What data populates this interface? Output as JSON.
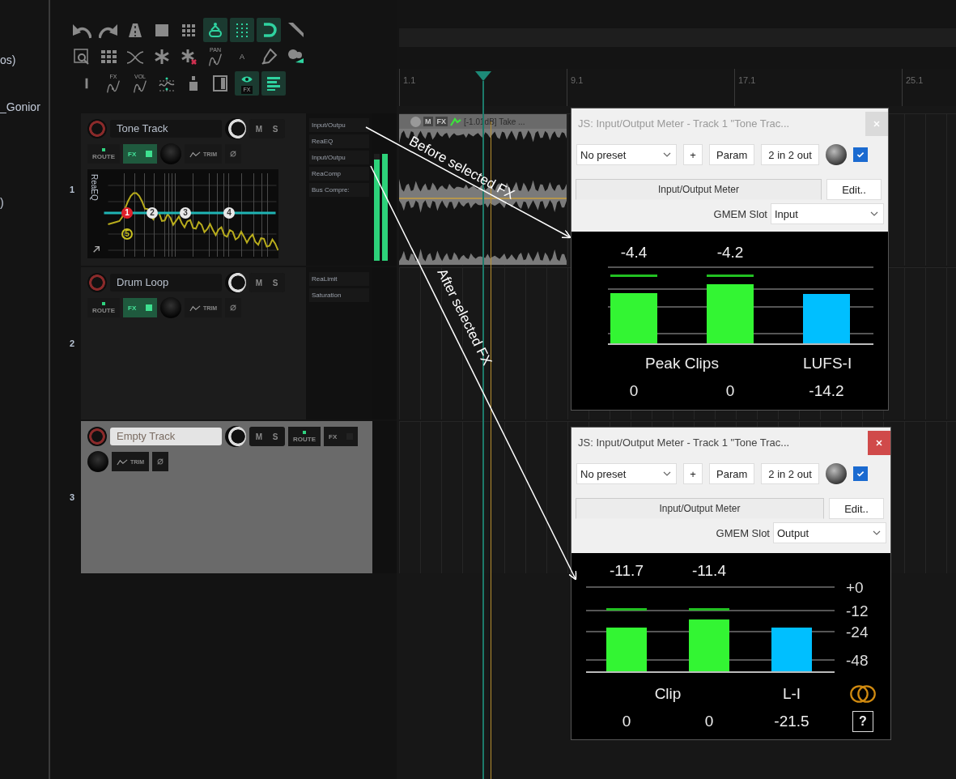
{
  "sidebar": {
    "items": [
      "os)",
      "_Gonior",
      ")"
    ]
  },
  "toolbar": {
    "rows": [
      [
        {
          "kind": "undo",
          "on": false
        },
        {
          "kind": "redo",
          "on": false
        },
        {
          "kind": "road",
          "on": false
        },
        {
          "kind": "square",
          "on": false
        },
        {
          "kind": "grid",
          "on": false
        },
        {
          "kind": "link",
          "on": true
        },
        {
          "kind": "dots",
          "on": true
        },
        {
          "kind": "magnet",
          "on": true
        },
        {
          "kind": "ruler",
          "on": false
        }
      ],
      [
        {
          "kind": "zoom",
          "on": false
        },
        {
          "kind": "table",
          "on": false
        },
        {
          "kind": "crossfade",
          "on": false
        },
        {
          "kind": "snowflake",
          "on": false
        },
        {
          "kind": "snowflake-x",
          "on": false
        },
        {
          "kind": "envelope",
          "label": "PAN",
          "on": false
        },
        {
          "kind": "text",
          "label": "A",
          "on": false
        },
        {
          "kind": "pin",
          "on": false
        },
        {
          "kind": "people",
          "on": false
        }
      ],
      [
        {
          "kind": "bar",
          "on": false
        },
        {
          "kind": "envelope",
          "label": "FX",
          "on": false
        },
        {
          "kind": "envelope",
          "label": "VOL",
          "on": false
        },
        {
          "kind": "points",
          "on": false
        },
        {
          "kind": "bottle",
          "on": false
        },
        {
          "kind": "panel",
          "on": false
        },
        {
          "kind": "eye",
          "label": "FX",
          "on": true
        },
        {
          "kind": "mixer",
          "on": true
        }
      ]
    ]
  },
  "tracks": [
    {
      "number": "1",
      "name": "Tone Track",
      "selected": false,
      "mute": "M",
      "solo": "S",
      "route": "ROUTE",
      "fx_button": "FX",
      "fx_enabled": true,
      "trim": "TRIM",
      "fx": [
        "Input/Outpu",
        "ReaEQ",
        "Input/Outpu",
        "ReaComp",
        "Bus Compre:"
      ],
      "meter": [
        {
          "level": 0.95
        },
        {
          "level": 1.0
        }
      ],
      "eq": {
        "title": "ReaEQ",
        "nodes": [
          {
            "label": "1",
            "kind": "filled",
            "color": "#e0202a"
          },
          {
            "label": "2",
            "kind": "filled",
            "color": "#e8e8e8"
          },
          {
            "label": "3",
            "kind": "filled",
            "color": "#e8e8e8"
          },
          {
            "label": "4",
            "kind": "filled",
            "color": "#e8e8e8"
          },
          {
            "label": "5",
            "kind": "outline",
            "color": "#c8c020"
          }
        ]
      },
      "item": {
        "mute": "M",
        "fx": "FX",
        "label": "[-1.01dB] Take ..."
      }
    },
    {
      "number": "2",
      "name": "Drum Loop",
      "selected": false,
      "mute": "M",
      "solo": "S",
      "route": "ROUTE",
      "fx_button": "FX",
      "fx_enabled": true,
      "trim": "TRIM",
      "fx": [
        "ReaLimit",
        "Saturation"
      ]
    },
    {
      "number": "3",
      "name": "Empty Track",
      "selected": true,
      "mute": "M",
      "solo": "S",
      "route": "ROUTE",
      "fx_button": "FX",
      "fx_enabled": false,
      "trim": "TRIM"
    }
  ],
  "ruler": [
    "1.1",
    "9.1",
    "17.1",
    "25.1"
  ],
  "annotations": [
    {
      "text": "Before selected FX"
    },
    {
      "text": "After selected FX"
    }
  ],
  "windows": [
    {
      "title": "JS: Input/Output Meter - Track 1 \"Tone Trac...",
      "active": false,
      "preset": "No preset",
      "add": "+",
      "param": "Param",
      "io": "2 in 2 out",
      "enabled": true,
      "name_field": "Input/Output Meter",
      "edit": "Edit..",
      "slot_label": "GMEM Slot",
      "slot": "Input",
      "meter": {
        "readouts": [
          "-4.4",
          "-4.2"
        ],
        "bars": [
          {
            "kind": "peak"
          },
          {
            "kind": "peak"
          },
          {
            "kind": "loudness"
          }
        ],
        "labels": [
          "Peak Clips",
          "LUFS-I"
        ],
        "values": [
          "0",
          "0",
          "-14.2"
        ]
      }
    },
    {
      "title": "JS: Input/Output Meter - Track 1 \"Tone Trac...",
      "active": true,
      "preset": "No preset",
      "add": "+",
      "param": "Param",
      "io": "2 in 2 out",
      "enabled": true,
      "name_field": "Input/Output Meter",
      "edit": "Edit..",
      "slot_label": "GMEM Slot",
      "slot": "Output",
      "meter": {
        "readouts": [
          "-11.7",
          "-11.4"
        ],
        "ticks": [
          "+0",
          "-12",
          "-24",
          "-48"
        ],
        "bars": [
          {
            "kind": "peak"
          },
          {
            "kind": "peak"
          },
          {
            "kind": "loudness"
          }
        ],
        "labels": [
          "Clip",
          "L-I"
        ],
        "values": [
          "0",
          "0",
          "-21.5"
        ],
        "help": "?"
      }
    }
  ]
}
